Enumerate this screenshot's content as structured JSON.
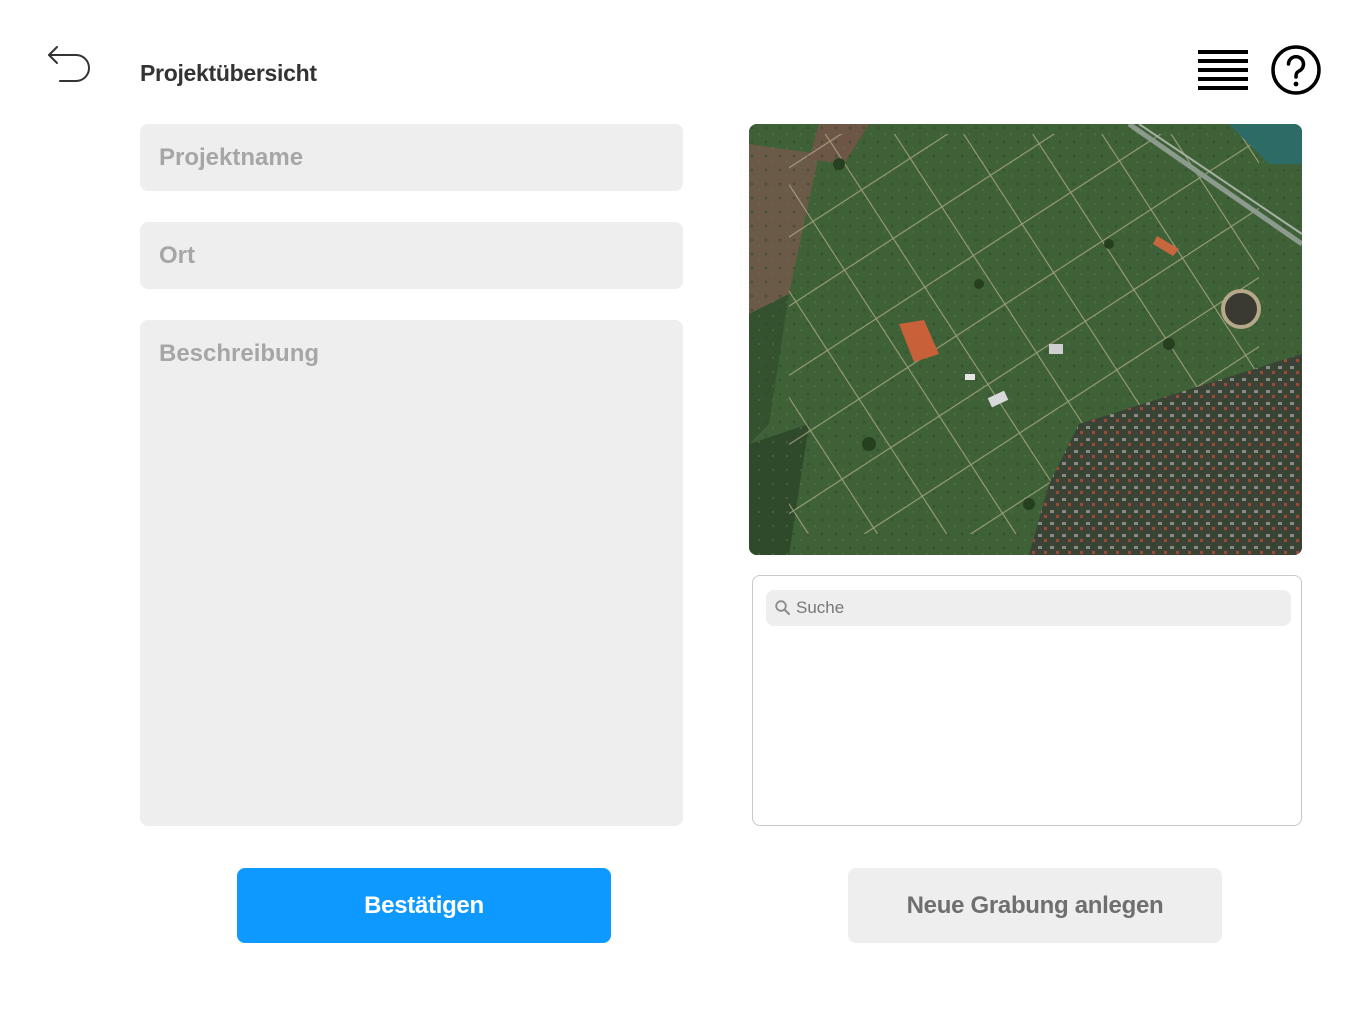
{
  "header": {
    "title": "Projektübersicht",
    "back_icon": "undo-arrow-icon",
    "menu_icon": "hamburger-menu-icon",
    "help_icon": "help-circle-icon"
  },
  "form": {
    "project_name": {
      "value": "",
      "placeholder": "Projektname"
    },
    "location": {
      "value": "",
      "placeholder": "Ort"
    },
    "description": {
      "value": "",
      "placeholder": "Beschreibung"
    }
  },
  "map": {
    "type": "satellite-image"
  },
  "search": {
    "placeholder": "Suche",
    "value": "",
    "icon": "search-icon",
    "results": []
  },
  "actions": {
    "confirm_label": "Bestätigen",
    "new_excavation_label": "Neue Grabung anlegen"
  },
  "colors": {
    "primary": "#0d99ff",
    "field_bg": "#eeeeee",
    "title_text": "#333333",
    "placeholder_text": "#a6a6a6"
  }
}
